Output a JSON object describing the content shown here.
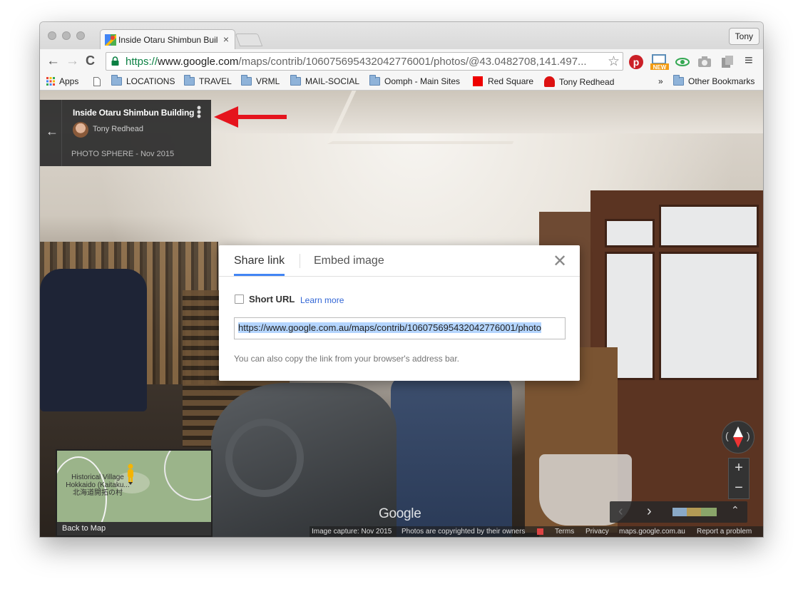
{
  "browser": {
    "tab_title": "Inside Otaru Shimbun Building",
    "tab_close": "×",
    "profile_name": "Tony",
    "url_scheme": "https://",
    "url_host": "www.google.com",
    "url_path": "/maps/contrib/106075695432042776001/photos/@43.0482708,141.497...",
    "back_glyph": "←",
    "forward_glyph": "→",
    "reload_glyph": "C",
    "star_glyph": "☆",
    "menu_glyph": "≡"
  },
  "bookmarks": {
    "apps": "Apps",
    "items": [
      "LOCATIONS",
      "TRAVEL",
      "VRML",
      "MAIL-SOCIAL",
      "Oomph - Main Sites",
      "Red Square",
      "Tony Redhead"
    ],
    "overflow": "»",
    "other": "Other Bookmarks"
  },
  "infocard": {
    "back_glyph": "←",
    "title": "Inside Otaru Shimbun Building",
    "author": "Tony Redhead",
    "meta": "PHOTO SPHERE - Nov 2015",
    "more_glyph": "⋮"
  },
  "share_dialog": {
    "tab_share": "Share link",
    "tab_embed": "Embed image",
    "close_glyph": "✕",
    "short_url_label": "Short URL",
    "learn_more": "Learn more",
    "link_value": "https://www.google.com.au/maps/contrib/106075695432042776001/photo",
    "hint": "You can also copy the link from your browser's address bar."
  },
  "controls": {
    "zoom_in": "+",
    "zoom_out": "−",
    "prev_glyph": "‹",
    "next_glyph": "›",
    "expand_glyph": "⌃"
  },
  "minimap": {
    "place_label_1": "Historical Village",
    "place_label_2": "Hokkaido (Kaitaku...",
    "place_label_3": "北海道開拓の村",
    "back_to_map": "Back to Map"
  },
  "watermark": "Google",
  "footer": {
    "capture": "Image capture: Nov 2015",
    "copyright": "Photos are copyrighted by their owners",
    "terms": "Terms",
    "privacy": "Privacy",
    "domain": "maps.google.com.au",
    "report": "Report a problem"
  },
  "colors": {
    "accent": "#4285f4",
    "link": "#3367d6",
    "annotation_arrow": "#e5141d",
    "secure_green": "#0b8043"
  }
}
